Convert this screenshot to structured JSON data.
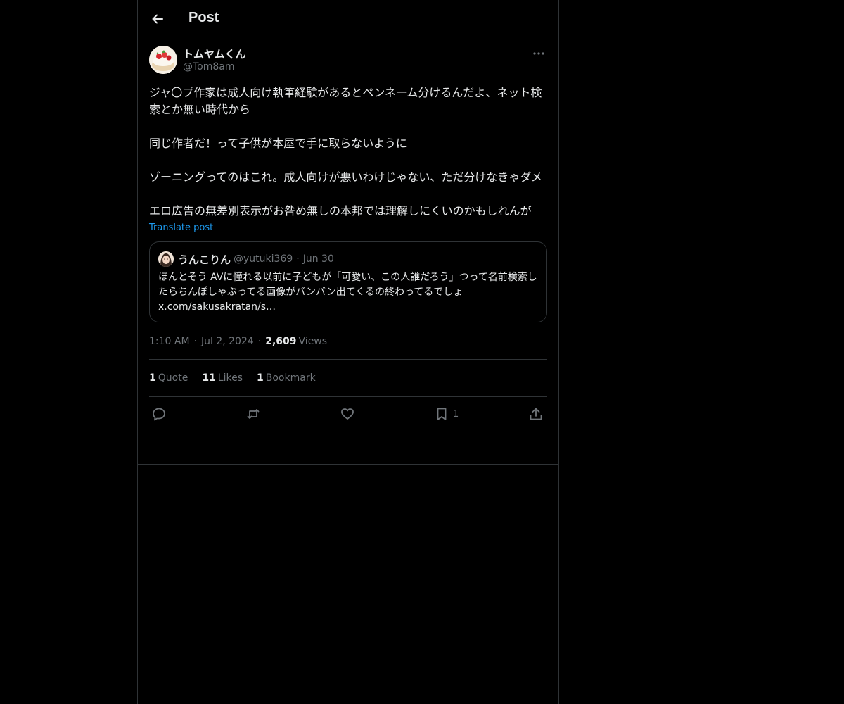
{
  "header": {
    "title": "Post",
    "back_icon": "arrow-left-icon"
  },
  "post": {
    "author_name": "トムヤムくん",
    "author_handle": "@Tom8am",
    "text": "ジャ〇プ作家は成人向け執筆経験があるとペンネーム分けるんだよ、ネット検索とか無い時代から\n\n同じ作者だ！って子供が本屋で手に取らないように\n\nゾーニングってのはこれ。成人向けが悪いわけじゃない、ただ分けなきゃダメ\n\nエロ広告の無差別表示がお咎め無しの本邦では理解しにくいのかもしれんが",
    "translate_label": "Translate post",
    "time": "1:10 AM",
    "date": "Jul 2, 2024",
    "views_count": "2,609",
    "views_label": "Views"
  },
  "quote": {
    "name": "うんこりん",
    "handle": "@yutuki369",
    "date": "Jun 30",
    "text": "ほんとそう AVに憧れる以前に子どもが「可愛い、この人誰だろう」つって名前検索したらちんぽしゃぶってる画像がバンバン出てくるの終わってるでしょ\nx.com/sakusakratan/s…"
  },
  "stats": {
    "quotes_count": "1",
    "quotes_label": "Quote",
    "likes_count": "11",
    "likes_label": "Likes",
    "bookmarks_count": "1",
    "bookmarks_label": "Bookmark"
  },
  "actions": {
    "bookmark_count": "1"
  },
  "colors": {
    "background": "#000000",
    "text": "#e7e9ea",
    "muted": "#71767b",
    "border": "#2f3336",
    "link": "#1d9bf0"
  }
}
